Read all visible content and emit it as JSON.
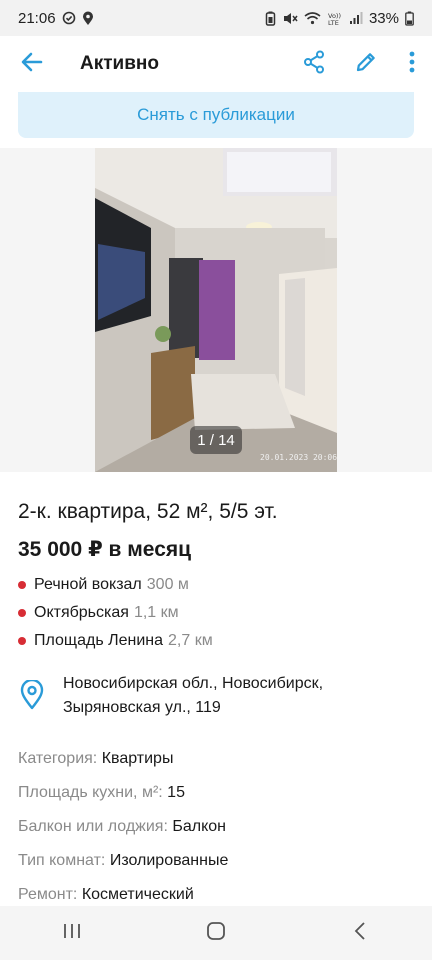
{
  "status_bar": {
    "time": "21:06",
    "battery": "33%"
  },
  "app_bar": {
    "title": "Активно"
  },
  "unpublish": {
    "label": "Снять с публикации"
  },
  "gallery": {
    "counter": "1 / 14",
    "photo_stamp": "20.01.2023 20:06"
  },
  "listing": {
    "title": "2-к. квартира, 52 м², 5/5 эт.",
    "price": "35 000 ₽ в месяц",
    "metro": [
      {
        "name": "Речной вокзал",
        "distance": "300 м"
      },
      {
        "name": "Октябрьская",
        "distance": "1,1 км"
      },
      {
        "name": "Площадь Ленина",
        "distance": "2,7 км"
      }
    ],
    "address_line1": "Новосибирская обл., Новосибирск,",
    "address_line2": "Зыряновская ул., 119",
    "params": [
      {
        "key": "Категория:",
        "value": "Квартиры"
      },
      {
        "key": "Площадь кухни, м²:",
        "value": "15"
      },
      {
        "key": "Балкон или лоджия:",
        "value": "Балкон"
      },
      {
        "key": "Тип комнат:",
        "value": "Изолированные"
      },
      {
        "key": "Ремонт:",
        "value": "Косметический"
      }
    ]
  },
  "colors": {
    "accent": "#2a9bd8",
    "metro_dot": "#d72d35",
    "unpublish_bg": "#dff1fb"
  },
  "icons": {
    "back": "arrow-left-icon",
    "share": "share-icon",
    "edit": "pencil-icon",
    "more": "more-vertical-icon",
    "pin": "location-pin-icon"
  }
}
